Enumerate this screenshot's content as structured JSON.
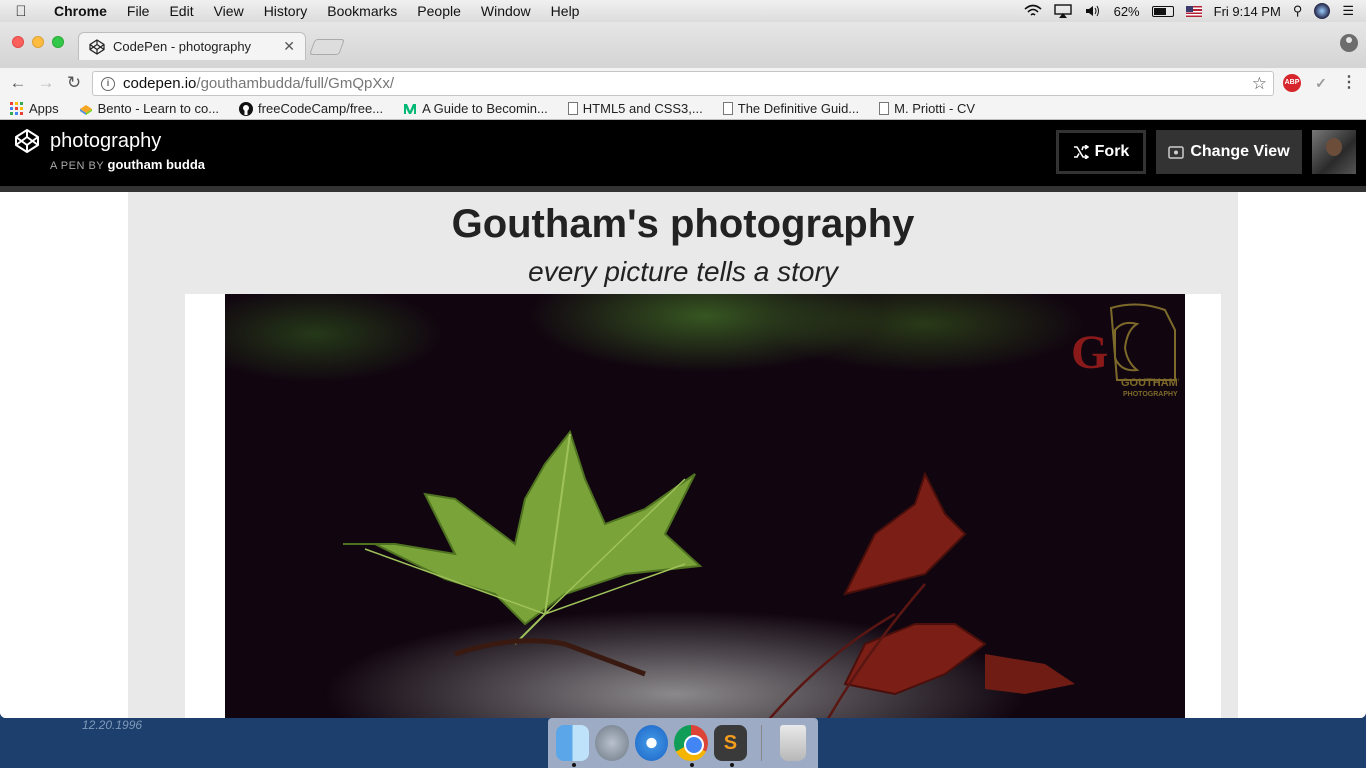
{
  "menubar": {
    "app_name": "Chrome",
    "items": [
      "File",
      "Edit",
      "View",
      "History",
      "Bookmarks",
      "People",
      "Window",
      "Help"
    ],
    "battery": "62%",
    "battery_level": 0.62,
    "clock": "Fri 9:14 PM"
  },
  "browser": {
    "tab_title": "CodePen - photography",
    "url_host": "codepen.io",
    "url_path": "/gouthambudda/full/GmQpXx/",
    "extensions": {
      "abp": "ABP"
    },
    "bookmarks": [
      {
        "label": "Apps",
        "icon": "apps-grid-icon"
      },
      {
        "label": "Bento - Learn to co...",
        "icon": "bento-icon"
      },
      {
        "label": "freeCodeCamp/free...",
        "icon": "github-icon"
      },
      {
        "label": "A Guide to Becomin...",
        "icon": "medium-icon"
      },
      {
        "label": "HTML5 and CSS3,...",
        "icon": "page-icon"
      },
      {
        "label": "The Definitive Guid...",
        "icon": "page-icon"
      },
      {
        "label": "M. Priotti - CV",
        "icon": "page-icon"
      }
    ]
  },
  "codepen": {
    "pen_title": "photography",
    "byline_prefix": "A PEN BY",
    "author": "goutham budda",
    "fork_label": "Fork",
    "change_view_label": "Change View"
  },
  "page": {
    "title": "Goutham's photography",
    "subtitle": "every picture tells a story",
    "watermark_text": "GOUTHAM'S PHOTOGRAPHY"
  },
  "desktop": {
    "date_text": "12.20.1996"
  },
  "dock": {
    "items": [
      "finder-icon",
      "launchpad-icon",
      "safari-icon",
      "chrome-icon",
      "sublime-text-icon",
      "trash-icon"
    ]
  },
  "colors": {
    "codepen_header": "#000000",
    "page_bg": "#e9e9e9",
    "photo_bg": "#110610",
    "leaf_green": "#7aa33a",
    "leaf_red": "#7a1e16"
  }
}
